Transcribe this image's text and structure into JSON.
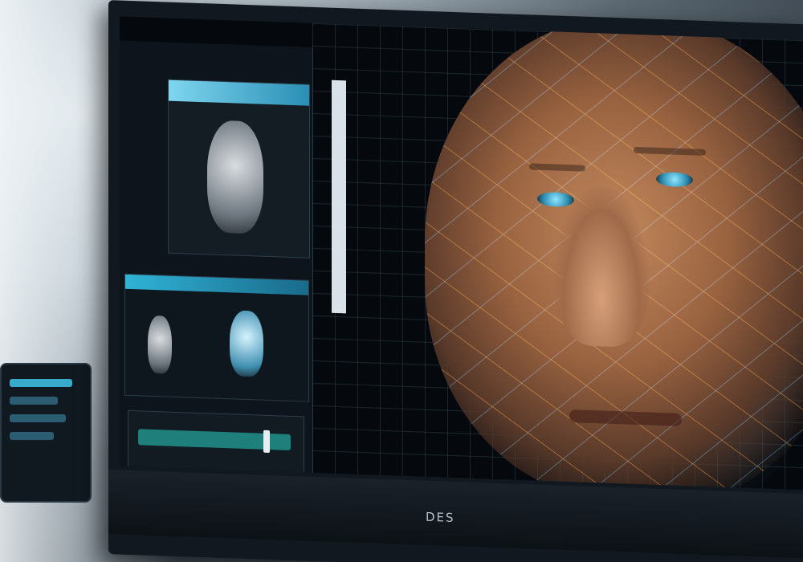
{
  "monitor": {
    "brand": "DES"
  }
}
